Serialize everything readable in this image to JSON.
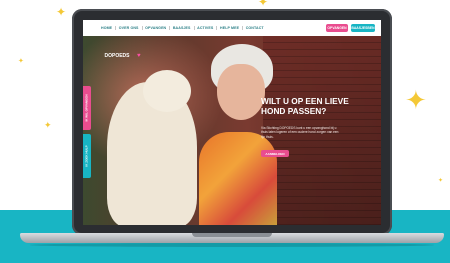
{
  "nav": {
    "links": [
      "HOME",
      "OVER ONS",
      "OPVANGEN",
      "BAASJES",
      "ACTIVES",
      "HELP MEE",
      "CONTACT"
    ],
    "buttons": [
      "OPVANGEN",
      "BAASJESBEN"
    ]
  },
  "hero": {
    "logo": "DOPOEDS",
    "headline_line1": "WILT U OP EEN LIEVE",
    "headline_line2": "HOND PASSEN?",
    "body": "Via Stichting DOPOEDS kunt u een opvanghond bij u thuis laten logeren of een oudere hond zorgen van een fijn thuis.",
    "cta": "AANMELDEN",
    "side_tab_top": "IK WIL OPVANGEN",
    "side_tab_bottom": "IK ZOEK HULP"
  },
  "colors": {
    "teal": "#18b5c4",
    "pink": "#e94d8f",
    "nav_text": "#2b7f86",
    "sparkle": "#f4c836"
  },
  "icons": [
    "sparkle-icon",
    "camera-icon",
    "heart-logo-icon"
  ]
}
